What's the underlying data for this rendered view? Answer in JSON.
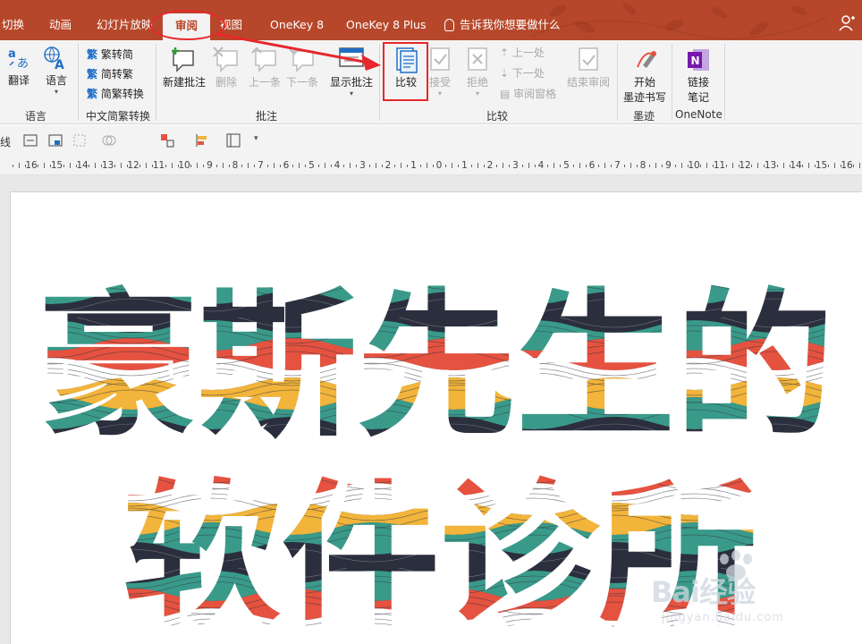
{
  "tabs": [
    {
      "label": "切换"
    },
    {
      "label": "动画"
    },
    {
      "label": "幻灯片放映"
    },
    {
      "label": "审阅"
    },
    {
      "label": "视图"
    },
    {
      "label": "OneKey 8"
    },
    {
      "label": "OneKey 8 Plus"
    }
  ],
  "tell_me": "告诉我你想要做什么",
  "ribbon": {
    "language": {
      "translate": "翻译",
      "lang": "语言",
      "group": "语言"
    },
    "chinese": {
      "t2s": "繁转简",
      "s2t": "简转繁",
      "convert": "简繁转换",
      "group": "中文简繁转换"
    },
    "comments": {
      "new": "新建批注",
      "delete": "删除",
      "prev": "上一条",
      "next": "下一条",
      "show": "显示批注",
      "group": "批注"
    },
    "compare": {
      "compare": "比较",
      "accept": "接受",
      "reject": "拒绝",
      "prev": "上一处",
      "next": "下一处",
      "pane": "审阅窗格",
      "end": "结束审阅",
      "group": "比较"
    },
    "ink": {
      "start_line1": "开始",
      "start_line2": "墨迹书写",
      "group": "墨迹"
    },
    "onenote": {
      "link_line1": "链接",
      "link_line2": "笔记",
      "group": "OneNote"
    }
  },
  "format_bar": {
    "line_label": "线"
  },
  "ruler": {
    "left_numbers": [
      "16",
      "15",
      "14",
      "13",
      "12",
      "11",
      "10",
      "9",
      "8",
      "7",
      "6",
      "5",
      "4",
      "3",
      "2",
      "1",
      "0"
    ],
    "right_numbers": [
      "1",
      "2",
      "3",
      "4",
      "5",
      "6",
      "7",
      "8",
      "9",
      "10",
      "11",
      "12",
      "13",
      "14",
      "15",
      "16"
    ]
  },
  "slide": {
    "line1": "豪斯先生的",
    "line2": "软件诊所",
    "palette": [
      "#2b2f3d",
      "#3a9a8a",
      "#e5523f",
      "#f2b43a",
      "#ffffff"
    ]
  },
  "watermark": {
    "main": "Bai经验",
    "sub": "jingyan.baidu.com"
  }
}
